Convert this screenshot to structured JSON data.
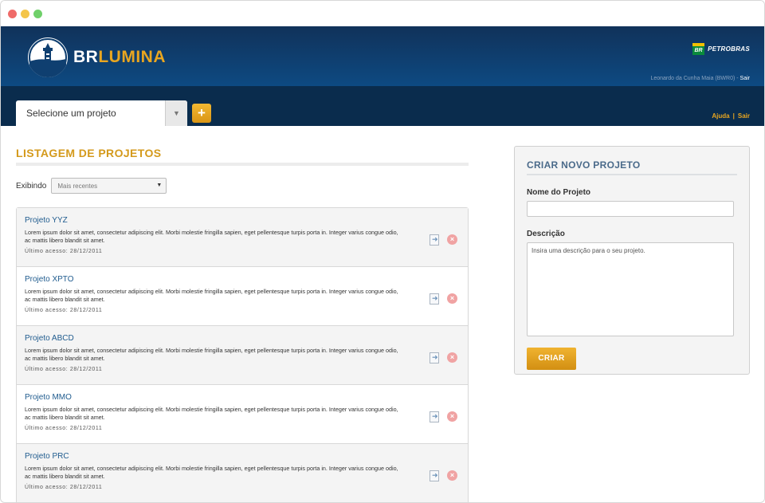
{
  "brand": {
    "prefix": "BR",
    "suffix": "LUMINA",
    "partner_badge": "BR",
    "partner": "PETROBRAS"
  },
  "user": {
    "name": "Leonardo da Cunha Maia (BWR0)",
    "separator": " - ",
    "logout": "Sair"
  },
  "nav": {
    "project_select_label": "Selecione um projeto",
    "add_button": "+",
    "help": "Ajuda",
    "separator": "|",
    "logout": "Sair"
  },
  "listing": {
    "title": "LISTAGEM DE PROJETOS",
    "filter_label": "Exibindo",
    "filter_value": "Mais recentes",
    "projects": [
      {
        "name": "Projeto YYZ",
        "description": "Lorem ipsum dolor sit amet, consectetur adipiscing elit. Morbi molestie fringilla sapien, eget pellentesque turpis porta in. Integer varius congue odio, ac mattis libero blandit sit amet.",
        "last_access": "Último acesso: 28/12/2011"
      },
      {
        "name": "Projeto XPTO",
        "description": "Lorem ipsum dolor sit amet, consectetur adipiscing elit. Morbi molestie fringilla sapien, eget pellentesque turpis porta in. Integer varius congue odio, ac mattis libero blandit sit amet.",
        "last_access": "Último acesso: 28/12/2011"
      },
      {
        "name": "Projeto ABCD",
        "description": "Lorem ipsum dolor sit amet, consectetur adipiscing elit. Morbi molestie fringilla sapien, eget pellentesque turpis porta in. Integer varius congue odio, ac mattis libero blandit sit amet.",
        "last_access": "Último acesso: 28/12/2011"
      },
      {
        "name": "Projeto MMO",
        "description": "Lorem ipsum dolor sit amet, consectetur adipiscing elit. Morbi molestie fringilla sapien, eget pellentesque turpis porta in. Integer varius congue odio, ac mattis libero blandit sit amet.",
        "last_access": "Último acesso: 28/12/2011"
      },
      {
        "name": "Projeto PRC",
        "description": "Lorem ipsum dolor sit amet, consectetur adipiscing elit. Morbi molestie fringilla sapien, eget pellentesque turpis porta in. Integer varius congue odio, ac mattis libero blandit sit amet.",
        "last_access": "Último acesso: 28/12/2011"
      }
    ]
  },
  "create": {
    "title": "CRIAR NOVO PROJETO",
    "name_label": "Nome do Projeto",
    "name_value": "",
    "description_label": "Descrição",
    "description_placeholder": "Insira uma descrição para o seu projeto.",
    "submit": "CRIAR"
  },
  "icons": {
    "edit": "document-arrow-icon",
    "delete": "delete-circle-icon"
  },
  "colors": {
    "header_dark": "#0a2c4d",
    "header_blue": "#0f3f70",
    "accent": "#e9a620",
    "link": "#1f5b8e"
  }
}
